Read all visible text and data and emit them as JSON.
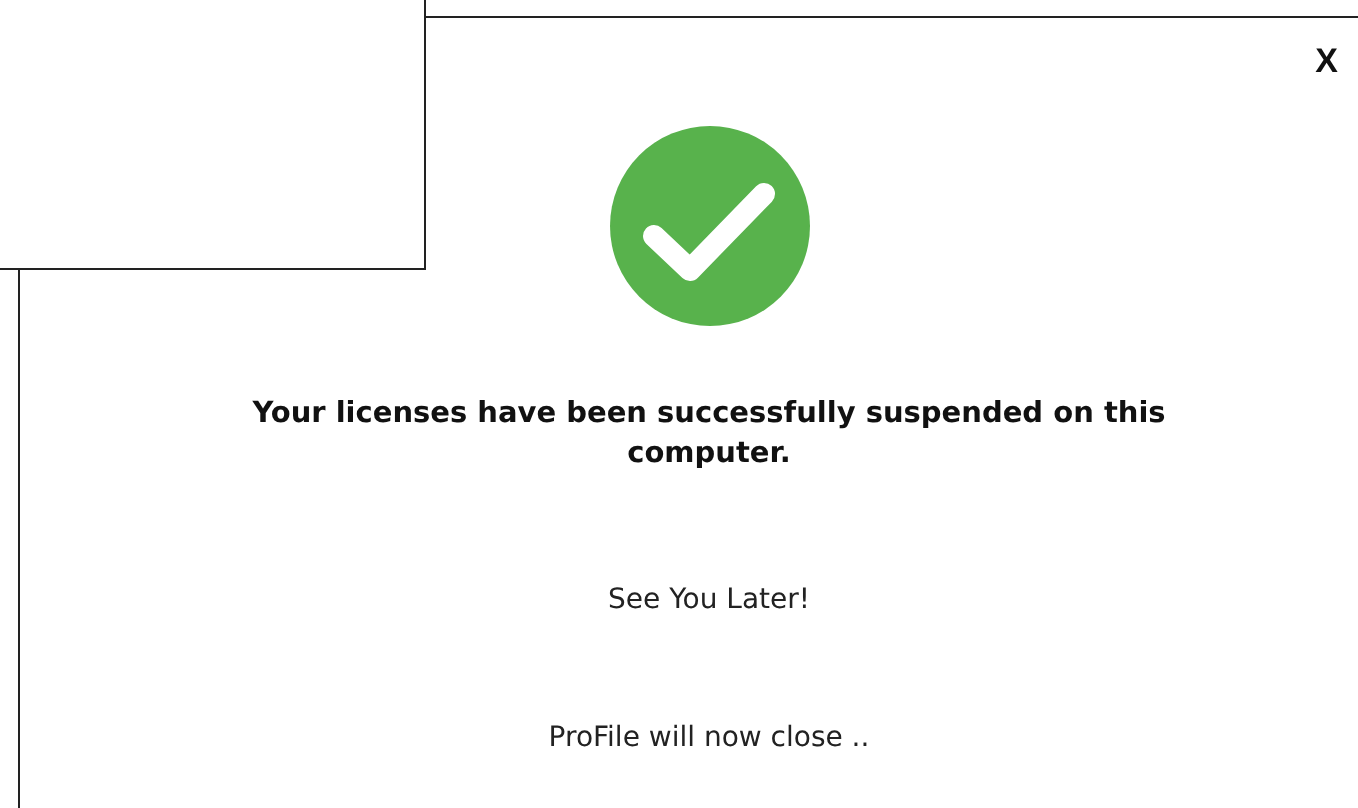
{
  "dialog": {
    "close_label": "X",
    "message": "Your licenses have been successfully suspended on this computer.",
    "farewell": "See You Later!",
    "closing_notice": "ProFile will now close .."
  }
}
